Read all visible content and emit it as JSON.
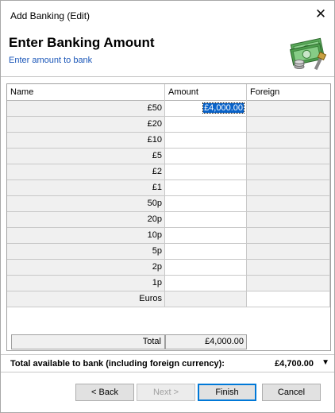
{
  "window": {
    "title": "Add Banking (Edit)"
  },
  "header": {
    "title": "Enter Banking Amount",
    "subtitle": "Enter amount to bank",
    "icon": "money-stack-icon"
  },
  "grid": {
    "columns": [
      "Name",
      "Amount",
      "Foreign"
    ],
    "rows": [
      {
        "name": "£50",
        "amount": "£4,000.00",
        "foreign": ""
      },
      {
        "name": "£20",
        "amount": "",
        "foreign": ""
      },
      {
        "name": "£10",
        "amount": "",
        "foreign": ""
      },
      {
        "name": "£5",
        "amount": "",
        "foreign": ""
      },
      {
        "name": "£2",
        "amount": "",
        "foreign": ""
      },
      {
        "name": "£1",
        "amount": "",
        "foreign": ""
      },
      {
        "name": "50p",
        "amount": "",
        "foreign": ""
      },
      {
        "name": "20p",
        "amount": "",
        "foreign": ""
      },
      {
        "name": "10p",
        "amount": "",
        "foreign": ""
      },
      {
        "name": "5p",
        "amount": "",
        "foreign": ""
      },
      {
        "name": "2p",
        "amount": "",
        "foreign": ""
      },
      {
        "name": "1p",
        "amount": "",
        "foreign": ""
      },
      {
        "name": "Euros",
        "amount": "",
        "foreign": ""
      }
    ],
    "total_label": "Total",
    "total_value": "£4,000.00"
  },
  "available": {
    "label": "Total available to bank (including foreign currency):",
    "value": "£4,700.00"
  },
  "buttons": {
    "back": "< Back",
    "next": "Next >",
    "finish": "Finish",
    "cancel": "Cancel"
  }
}
